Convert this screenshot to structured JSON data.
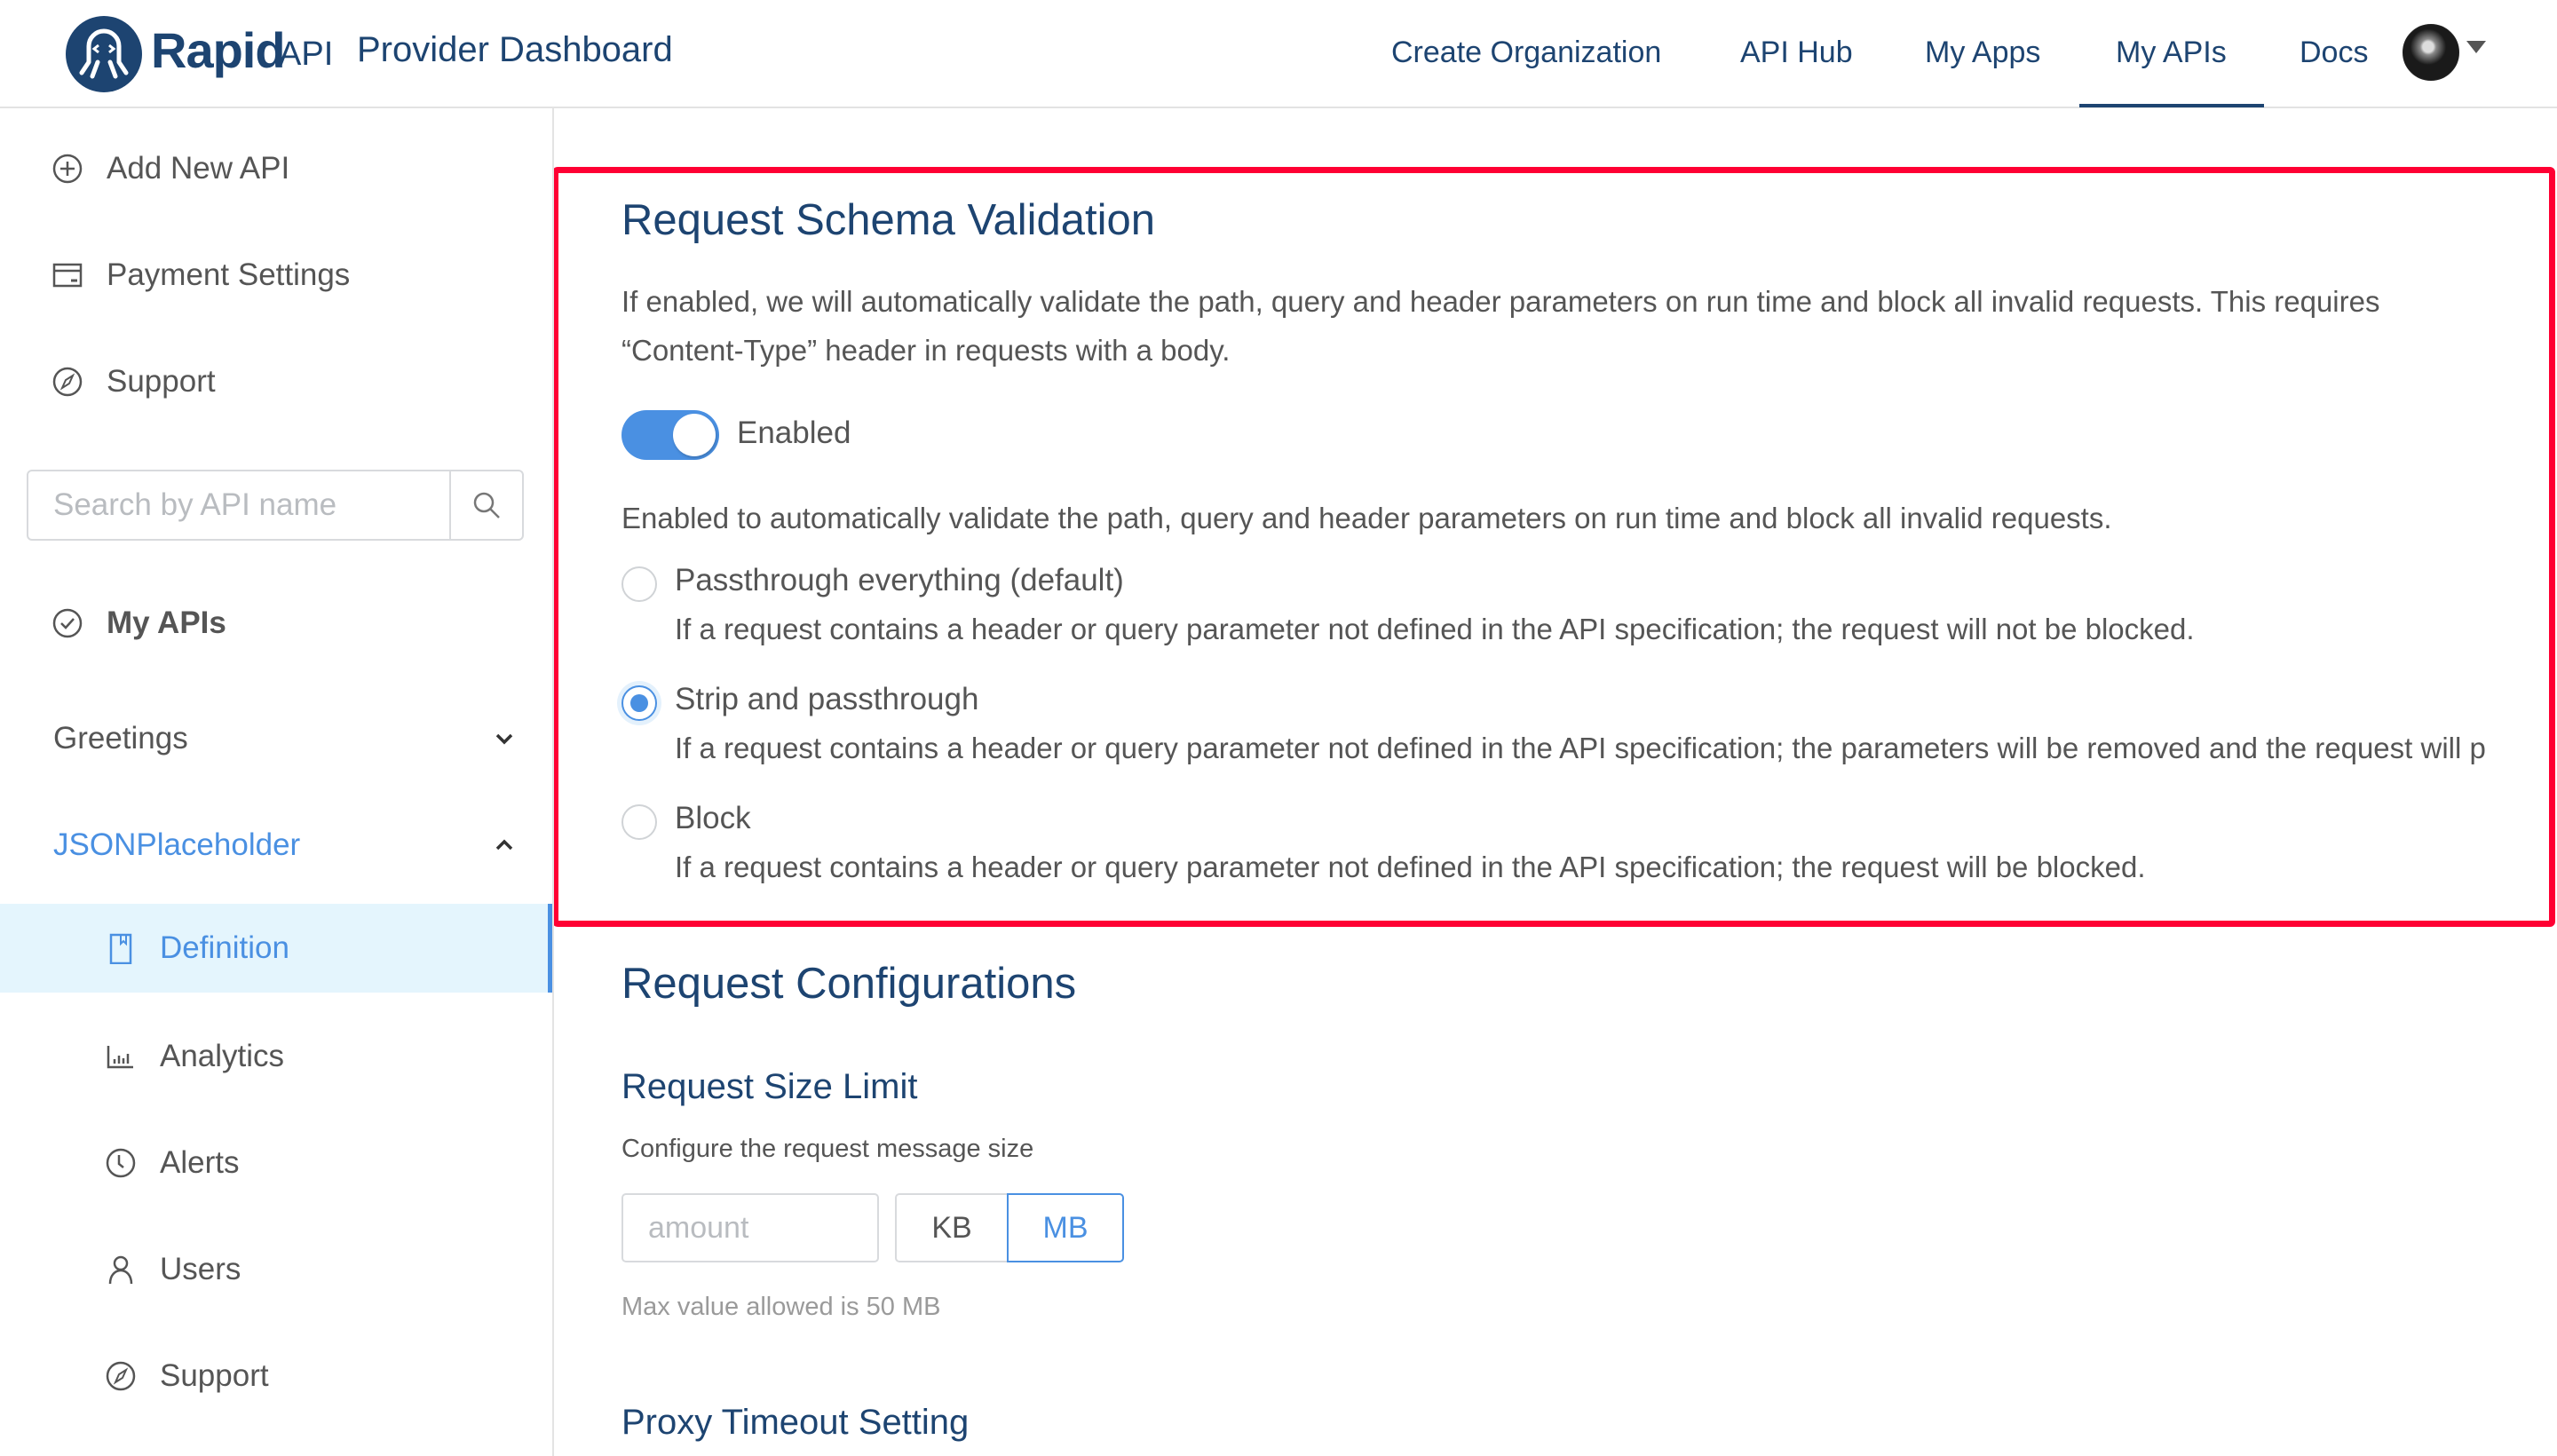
{
  "header": {
    "brand": "Rapid",
    "brand_suffix": "API",
    "title": "Provider Dashboard",
    "nav": [
      {
        "label": "Create Organization"
      },
      {
        "label": "API Hub"
      },
      {
        "label": "My Apps"
      },
      {
        "label": "My APIs",
        "active": true
      },
      {
        "label": "Docs"
      }
    ],
    "avatar_icon": "user-avatar",
    "caret_icon": "caret-down-icon"
  },
  "sidebar": {
    "top_items": [
      {
        "label": "Add New API",
        "icon": "plus-circle-icon"
      },
      {
        "label": "Payment Settings",
        "icon": "credit-card-icon"
      },
      {
        "label": "Support",
        "icon": "compass-icon"
      }
    ],
    "search": {
      "placeholder": "Search by API name",
      "value": ""
    },
    "my_apis_label": "My APIs",
    "apis": [
      {
        "label": "Greetings",
        "expanded": false
      },
      {
        "label": "JSONPlaceholder",
        "expanded": true
      }
    ],
    "sub_items": [
      {
        "label": "Definition",
        "icon": "book-icon",
        "active": true
      },
      {
        "label": "Analytics",
        "icon": "bar-chart-icon"
      },
      {
        "label": "Alerts",
        "icon": "clock-icon"
      },
      {
        "label": "Users",
        "icon": "user-icon"
      },
      {
        "label": "Support",
        "icon": "compass-icon"
      }
    ]
  },
  "main": {
    "schema_validation": {
      "title": "Request Schema Validation",
      "description_line1": "If enabled, we will automatically validate the path, query and header parameters on run time and block all invalid requests. This requires",
      "description_line2": "“Content-Type” header in requests with a body.",
      "toggle_label": "Enabled",
      "toggle_on": true,
      "enabled_description": "Enabled to automatically validate the path, query and header parameters on run time and block all invalid requests.",
      "options": [
        {
          "label": "Passthrough everything (default)",
          "description": "If a request contains a header or query parameter not defined in the API specification; the request will not be blocked.",
          "selected": false
        },
        {
          "label": "Strip and passthrough",
          "description": "If a request contains a header or query parameter not defined in the API specification; the parameters will be removed and the request will p",
          "selected": true
        },
        {
          "label": "Block",
          "description": "If a request contains a header or query parameter not defined in the API specification; the request will be blocked.",
          "selected": false
        }
      ]
    },
    "request_config": {
      "title": "Request Configurations",
      "size_limit_title": "Request Size Limit",
      "size_limit_desc": "Configure the request message size",
      "amount_placeholder": "amount",
      "amount_value": "",
      "units": [
        "KB",
        "MB"
      ],
      "selected_unit": "MB",
      "hint": "Max value allowed is 50 MB",
      "proxy_timeout_title": "Proxy Timeout Setting"
    }
  },
  "colors": {
    "brand_navy": "#1d4471",
    "accent_blue": "#4a90e2",
    "highlight_red": "#ff0033",
    "active_row_bg": "#e4f5fd"
  }
}
